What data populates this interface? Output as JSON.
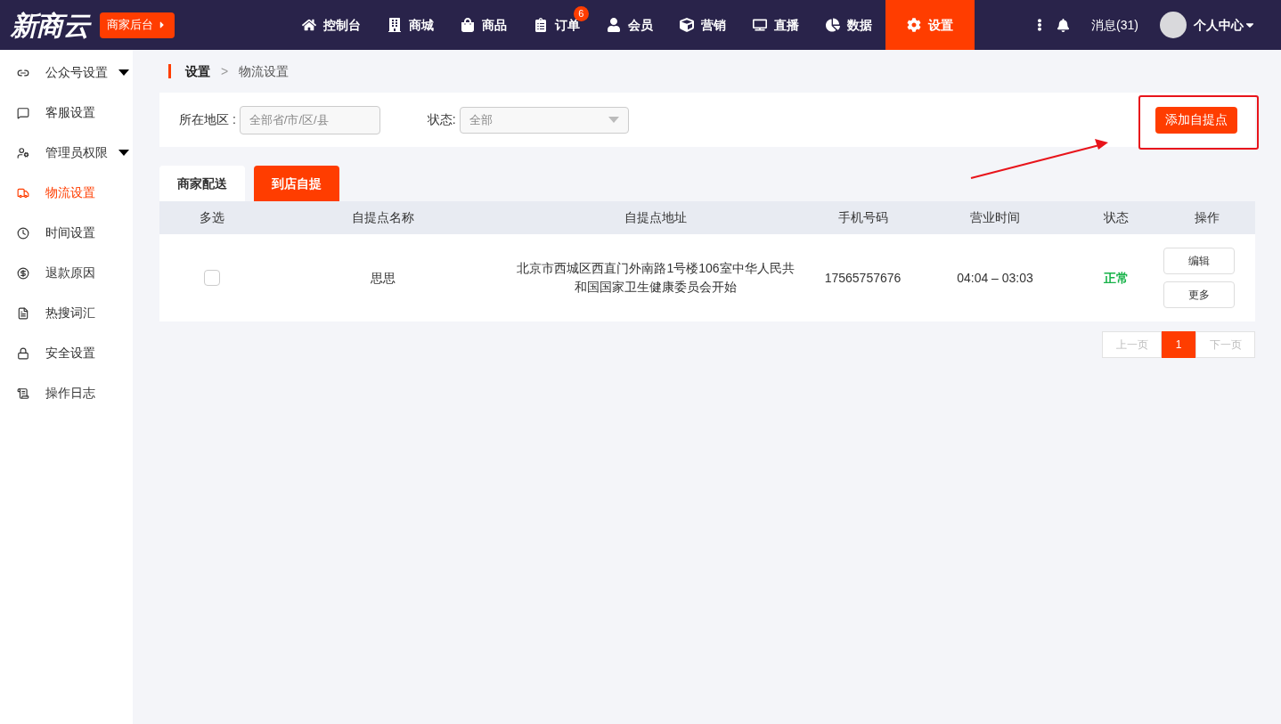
{
  "header": {
    "logo": "新商云",
    "backend_button": "商家后台",
    "nav": [
      {
        "label": "控制台",
        "selected": false
      },
      {
        "label": "商城",
        "selected": false
      },
      {
        "label": "商品",
        "selected": false
      },
      {
        "label": "订单",
        "selected": false,
        "badge": "6"
      },
      {
        "label": "会员",
        "selected": false
      },
      {
        "label": "营销",
        "selected": false
      },
      {
        "label": "直播",
        "selected": false
      },
      {
        "label": "数据",
        "selected": false
      },
      {
        "label": "设置",
        "selected": true
      }
    ],
    "messages": "消息(31)",
    "user": "个人中心"
  },
  "sidebar": {
    "items": [
      {
        "label": "公众号设置",
        "selected": false,
        "expandable": true
      },
      {
        "label": "客服设置",
        "selected": false,
        "expandable": false
      },
      {
        "label": "管理员权限",
        "selected": false,
        "expandable": true
      },
      {
        "label": "物流设置",
        "selected": true,
        "expandable": false
      },
      {
        "label": "时间设置",
        "selected": false,
        "expandable": false
      },
      {
        "label": "退款原因",
        "selected": false,
        "expandable": false
      },
      {
        "label": "热搜词汇",
        "selected": false,
        "expandable": false
      },
      {
        "label": "安全设置",
        "selected": false,
        "expandable": false
      },
      {
        "label": "操作日志",
        "selected": false,
        "expandable": false
      }
    ]
  },
  "breadcrumb": {
    "items": [
      "设置",
      "物流设置"
    ],
    "separator": ">"
  },
  "filters": {
    "region_label": "所在地区 :",
    "region_placeholder": "全部省/市/区/县",
    "status_label": "状态:",
    "status_value": "全部"
  },
  "add_button": "添加自提点",
  "tabs": [
    {
      "label": "商家配送",
      "selected": false
    },
    {
      "label": "到店自提",
      "selected": true
    }
  ],
  "table": {
    "columns": [
      "多选",
      "自提点名称",
      "自提点地址",
      "手机号码",
      "营业时间",
      "状态",
      "操作"
    ],
    "rows": [
      {
        "checked": false,
        "name": "思思",
        "address": "北京市西城区西直门外南路1号楼106室中华人民共和国国家卫生健康委员会开始",
        "phone": "17565757676",
        "hours": "04:04 – 03:03",
        "status": "正常",
        "actions": [
          "编辑",
          "更多"
        ]
      }
    ]
  },
  "pagination": {
    "prev": "上一页",
    "prev_disabled": true,
    "pages": [
      {
        "label": "1",
        "selected": true
      }
    ],
    "next": "下一页",
    "next_disabled": true
  }
}
